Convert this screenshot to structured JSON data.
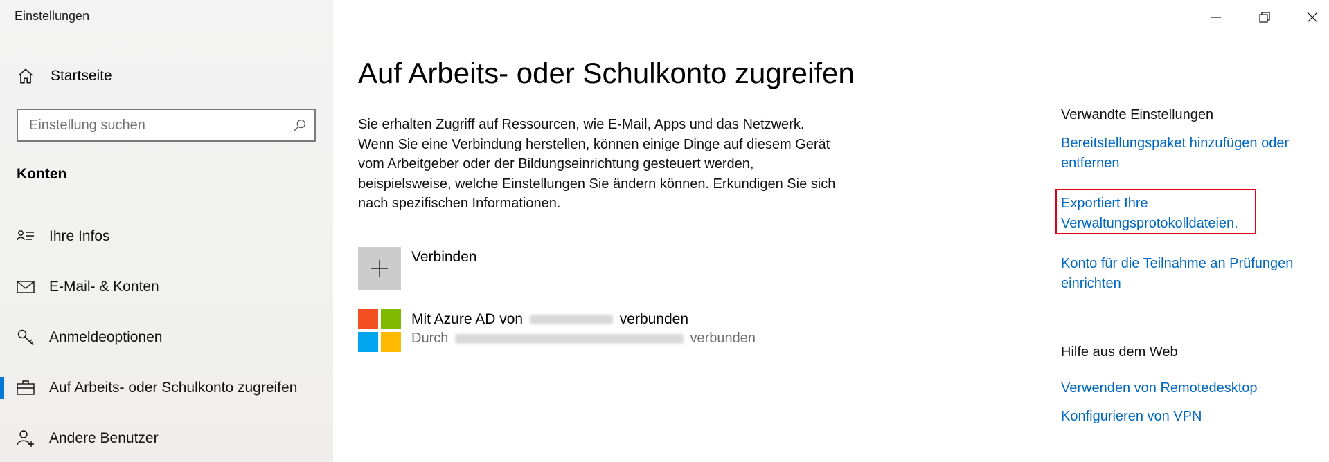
{
  "window": {
    "title": "Einstellungen"
  },
  "sidebar": {
    "home_label": "Startseite",
    "search_placeholder": "Einstellung suchen",
    "section_title": "Konten",
    "items": [
      {
        "label": "Ihre Infos",
        "icon": "person-card-icon"
      },
      {
        "label": "E-Mail- & Konten",
        "icon": "mail-icon"
      },
      {
        "label": "Anmeldeoptionen",
        "icon": "key-icon"
      },
      {
        "label": "Auf Arbeits- oder Schulkonto zugreifen",
        "icon": "briefcase-icon",
        "active": true
      },
      {
        "label": "Andere Benutzer",
        "icon": "person-add-icon"
      }
    ]
  },
  "main": {
    "title": "Auf Arbeits- oder Schulkonto zugreifen",
    "description": "Sie erhalten Zugriff auf Ressourcen, wie E-Mail, Apps und das Netzwerk. Wenn Sie eine Verbindung herstellen, können einige Dinge auf diesem Gerät vom Arbeitgeber oder der Bildungseinrichtung gesteuert werden, beispielsweise, welche Einstellungen Sie ändern können. Erkundigen Sie sich nach spezifischen Informationen.",
    "connect_label": "Verbinden",
    "account": {
      "line1_prefix": "Mit Azure AD von",
      "line1_suffix": "verbunden",
      "line2_prefix": "Durch",
      "line2_suffix": "verbunden"
    }
  },
  "related": {
    "heading": "Verwandte Einstellungen",
    "links": [
      "Bereitstellungspaket hinzufügen oder entfernen",
      "Exportiert Ihre Verwaltungsprotokolldateien.",
      "Konto für die Teilnahme an Prüfungen einrichten"
    ]
  },
  "help": {
    "heading": "Hilfe aus dem Web",
    "links": [
      "Verwenden von Remotedesktop",
      "Konfigurieren von VPN"
    ]
  },
  "colors": {
    "accent": "#0078d7",
    "link": "#0067c0",
    "highlight": "#e0001b",
    "ms_red": "#f25022",
    "ms_green": "#7fba00",
    "ms_blue": "#00a4ef",
    "ms_yellow": "#ffb900"
  }
}
